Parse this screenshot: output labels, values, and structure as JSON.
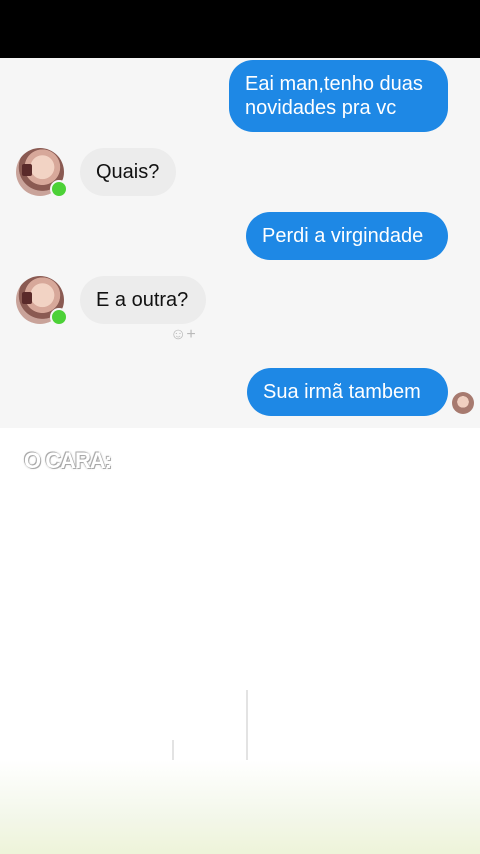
{
  "conversation": {
    "messages": [
      {
        "sender": "me",
        "text_line1": "Eai man,tenho duas",
        "text_line2": "novidades pra vc"
      },
      {
        "sender": "friend",
        "text": "Quais?"
      },
      {
        "sender": "me",
        "text": "Perdi a virgindade"
      },
      {
        "sender": "friend",
        "text": "E a outra?"
      },
      {
        "sender": "me",
        "text": "Sua irmã tambem"
      }
    ],
    "reaction_icon": "smile-plus-icon",
    "online_color": "#4cd137",
    "outgoing_color": "#1e88e5",
    "incoming_color": "#ececec"
  },
  "caption": {
    "text": "O CARA:"
  }
}
